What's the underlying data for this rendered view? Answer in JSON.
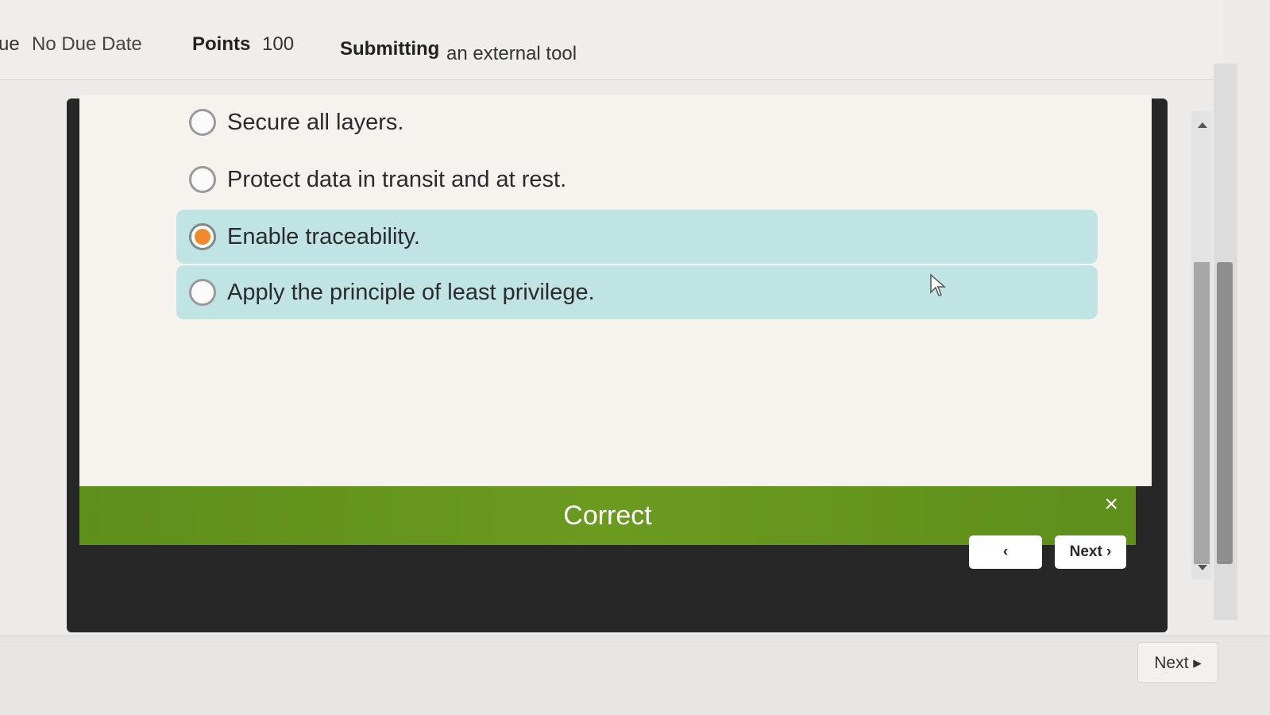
{
  "header": {
    "due_prefix": "ue",
    "due_value": "No Due Date",
    "points_label": "Points",
    "points_value": "100",
    "submitting_label": "Submitting",
    "submitting_value": "an external tool"
  },
  "quiz": {
    "options": [
      {
        "label": "Secure all layers.",
        "selected": false
      },
      {
        "label": "Protect data in transit and at rest.",
        "selected": false
      },
      {
        "label": "Enable traceability.",
        "selected": true
      },
      {
        "label": "Apply the principle of least privilege.",
        "selected": false
      }
    ],
    "feedback": "Correct",
    "close_icon": "×",
    "prev_label": "‹",
    "next_label": "Next ›"
  },
  "footer": {
    "next_label": "Next ▸"
  },
  "colors": {
    "correct_bar": "#6a9a1e",
    "selected_dot": "#ef8a2b",
    "highlight": "#bfe4e3"
  }
}
